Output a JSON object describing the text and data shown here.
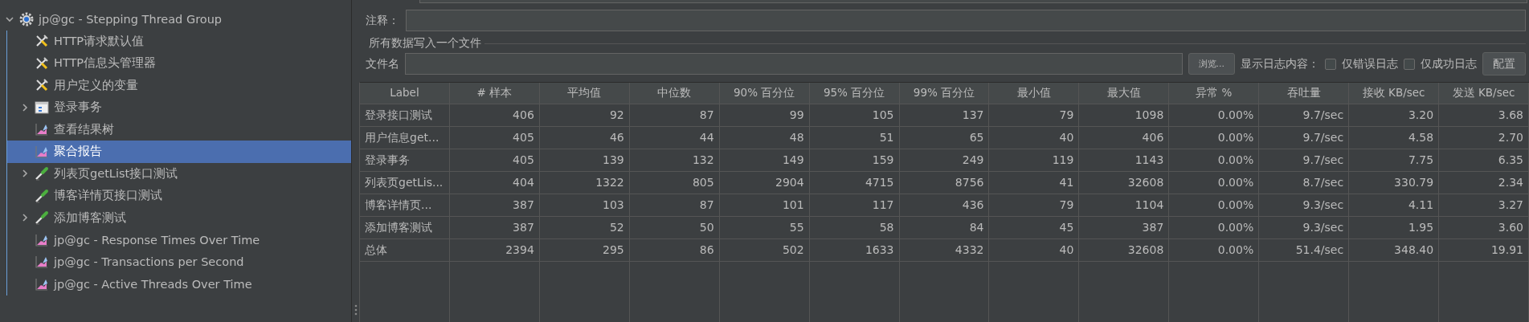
{
  "tree": {
    "root": {
      "label": "jp@gc - Stepping Thread Group",
      "kind": "thread-group",
      "expanded": true,
      "selected": false,
      "children": [
        {
          "label": "HTTP请求默认值",
          "kind": "config",
          "expandable": false,
          "selected": false
        },
        {
          "label": "HTTP信息头管理器",
          "kind": "config",
          "expandable": false,
          "selected": false
        },
        {
          "label": "用户定义的变量",
          "kind": "config",
          "expandable": false,
          "selected": false
        },
        {
          "label": "登录事务",
          "kind": "transaction",
          "expandable": true,
          "selected": false
        },
        {
          "label": "查看结果树",
          "kind": "listener",
          "expandable": false,
          "selected": false
        },
        {
          "label": "聚合报告",
          "kind": "listener",
          "expandable": false,
          "selected": true
        },
        {
          "label": "列表页getList接口测试",
          "kind": "sampler",
          "expandable": true,
          "selected": false
        },
        {
          "label": "博客详情页接口测试",
          "kind": "sampler",
          "expandable": false,
          "selected": false
        },
        {
          "label": "添加博客测试",
          "kind": "sampler",
          "expandable": true,
          "selected": false
        },
        {
          "label": "jp@gc - Response Times Over Time",
          "kind": "listener",
          "expandable": false,
          "selected": false
        },
        {
          "label": "jp@gc - Transactions per Second",
          "kind": "listener",
          "expandable": false,
          "selected": false
        },
        {
          "label": "jp@gc - Active Threads Over Time",
          "kind": "listener",
          "expandable": false,
          "selected": false
        }
      ]
    }
  },
  "form": {
    "comment_label": "注释：",
    "group_title": "所有数据写入一个文件",
    "filename_label": "文件名",
    "browse_button": "浏览...",
    "log_label": "显示日志内容：",
    "checkboxes": [
      {
        "label": "仅错误日志",
        "checked": false
      },
      {
        "label": "仅成功日志",
        "checked": false
      }
    ],
    "config_button": "配置"
  },
  "table": {
    "columns": [
      "Label",
      "# 样本",
      "平均值",
      "中位数",
      "90% 百分位",
      "95% 百分位",
      "99% 百分位",
      "最小值",
      "最大值",
      "异常 %",
      "吞吐量",
      "接收 KB/sec",
      "发送 KB/sec"
    ],
    "rows": [
      [
        "登录接口测试",
        "406",
        "92",
        "87",
        "99",
        "105",
        "137",
        "79",
        "1098",
        "0.00%",
        "9.7/sec",
        "3.20",
        "3.68"
      ],
      [
        "用户信息get...",
        "405",
        "46",
        "44",
        "48",
        "51",
        "65",
        "40",
        "406",
        "0.00%",
        "9.7/sec",
        "4.58",
        "2.70"
      ],
      [
        "登录事务",
        "405",
        "139",
        "132",
        "149",
        "159",
        "249",
        "119",
        "1143",
        "0.00%",
        "9.7/sec",
        "7.75",
        "6.35"
      ],
      [
        "列表页getLis...",
        "404",
        "1322",
        "805",
        "2904",
        "4715",
        "8756",
        "41",
        "32608",
        "0.00%",
        "8.7/sec",
        "330.79",
        "2.34"
      ],
      [
        "博客详情页...",
        "387",
        "103",
        "87",
        "101",
        "117",
        "436",
        "79",
        "1104",
        "0.00%",
        "9.3/sec",
        "4.11",
        "3.27"
      ],
      [
        "添加博客测试",
        "387",
        "52",
        "50",
        "55",
        "58",
        "84",
        "45",
        "387",
        "0.00%",
        "9.3/sec",
        "1.95",
        "3.60"
      ],
      [
        "总体",
        "2394",
        "295",
        "86",
        "502",
        "1633",
        "4332",
        "40",
        "32608",
        "0.00%",
        "51.4/sec",
        "348.40",
        "19.91"
      ]
    ]
  }
}
